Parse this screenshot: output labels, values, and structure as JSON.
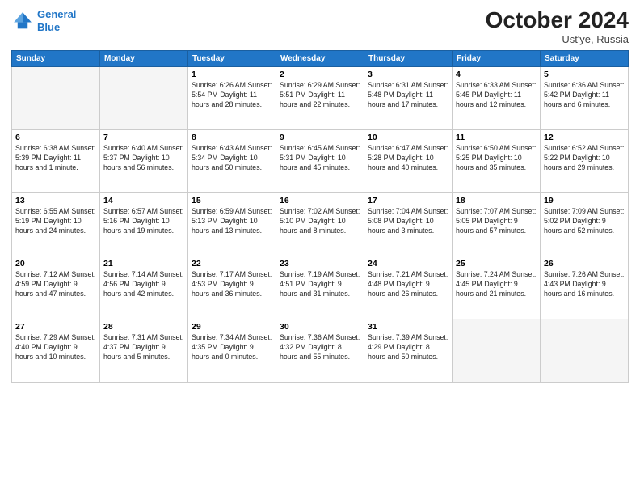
{
  "logo": {
    "line1": "General",
    "line2": "Blue"
  },
  "title": "October 2024",
  "location": "Ust'ye, Russia",
  "days_of_week": [
    "Sunday",
    "Monday",
    "Tuesday",
    "Wednesday",
    "Thursday",
    "Friday",
    "Saturday"
  ],
  "weeks": [
    [
      {
        "day": "",
        "text": ""
      },
      {
        "day": "",
        "text": ""
      },
      {
        "day": "1",
        "text": "Sunrise: 6:26 AM\nSunset: 5:54 PM\nDaylight: 11 hours and 28 minutes."
      },
      {
        "day": "2",
        "text": "Sunrise: 6:29 AM\nSunset: 5:51 PM\nDaylight: 11 hours and 22 minutes."
      },
      {
        "day": "3",
        "text": "Sunrise: 6:31 AM\nSunset: 5:48 PM\nDaylight: 11 hours and 17 minutes."
      },
      {
        "day": "4",
        "text": "Sunrise: 6:33 AM\nSunset: 5:45 PM\nDaylight: 11 hours and 12 minutes."
      },
      {
        "day": "5",
        "text": "Sunrise: 6:36 AM\nSunset: 5:42 PM\nDaylight: 11 hours and 6 minutes."
      }
    ],
    [
      {
        "day": "6",
        "text": "Sunrise: 6:38 AM\nSunset: 5:39 PM\nDaylight: 11 hours and 1 minute."
      },
      {
        "day": "7",
        "text": "Sunrise: 6:40 AM\nSunset: 5:37 PM\nDaylight: 10 hours and 56 minutes."
      },
      {
        "day": "8",
        "text": "Sunrise: 6:43 AM\nSunset: 5:34 PM\nDaylight: 10 hours and 50 minutes."
      },
      {
        "day": "9",
        "text": "Sunrise: 6:45 AM\nSunset: 5:31 PM\nDaylight: 10 hours and 45 minutes."
      },
      {
        "day": "10",
        "text": "Sunrise: 6:47 AM\nSunset: 5:28 PM\nDaylight: 10 hours and 40 minutes."
      },
      {
        "day": "11",
        "text": "Sunrise: 6:50 AM\nSunset: 5:25 PM\nDaylight: 10 hours and 35 minutes."
      },
      {
        "day": "12",
        "text": "Sunrise: 6:52 AM\nSunset: 5:22 PM\nDaylight: 10 hours and 29 minutes."
      }
    ],
    [
      {
        "day": "13",
        "text": "Sunrise: 6:55 AM\nSunset: 5:19 PM\nDaylight: 10 hours and 24 minutes."
      },
      {
        "day": "14",
        "text": "Sunrise: 6:57 AM\nSunset: 5:16 PM\nDaylight: 10 hours and 19 minutes."
      },
      {
        "day": "15",
        "text": "Sunrise: 6:59 AM\nSunset: 5:13 PM\nDaylight: 10 hours and 13 minutes."
      },
      {
        "day": "16",
        "text": "Sunrise: 7:02 AM\nSunset: 5:10 PM\nDaylight: 10 hours and 8 minutes."
      },
      {
        "day": "17",
        "text": "Sunrise: 7:04 AM\nSunset: 5:08 PM\nDaylight: 10 hours and 3 minutes."
      },
      {
        "day": "18",
        "text": "Sunrise: 7:07 AM\nSunset: 5:05 PM\nDaylight: 9 hours and 57 minutes."
      },
      {
        "day": "19",
        "text": "Sunrise: 7:09 AM\nSunset: 5:02 PM\nDaylight: 9 hours and 52 minutes."
      }
    ],
    [
      {
        "day": "20",
        "text": "Sunrise: 7:12 AM\nSunset: 4:59 PM\nDaylight: 9 hours and 47 minutes."
      },
      {
        "day": "21",
        "text": "Sunrise: 7:14 AM\nSunset: 4:56 PM\nDaylight: 9 hours and 42 minutes."
      },
      {
        "day": "22",
        "text": "Sunrise: 7:17 AM\nSunset: 4:53 PM\nDaylight: 9 hours and 36 minutes."
      },
      {
        "day": "23",
        "text": "Sunrise: 7:19 AM\nSunset: 4:51 PM\nDaylight: 9 hours and 31 minutes."
      },
      {
        "day": "24",
        "text": "Sunrise: 7:21 AM\nSunset: 4:48 PM\nDaylight: 9 hours and 26 minutes."
      },
      {
        "day": "25",
        "text": "Sunrise: 7:24 AM\nSunset: 4:45 PM\nDaylight: 9 hours and 21 minutes."
      },
      {
        "day": "26",
        "text": "Sunrise: 7:26 AM\nSunset: 4:43 PM\nDaylight: 9 hours and 16 minutes."
      }
    ],
    [
      {
        "day": "27",
        "text": "Sunrise: 7:29 AM\nSunset: 4:40 PM\nDaylight: 9 hours and 10 minutes."
      },
      {
        "day": "28",
        "text": "Sunrise: 7:31 AM\nSunset: 4:37 PM\nDaylight: 9 hours and 5 minutes."
      },
      {
        "day": "29",
        "text": "Sunrise: 7:34 AM\nSunset: 4:35 PM\nDaylight: 9 hours and 0 minutes."
      },
      {
        "day": "30",
        "text": "Sunrise: 7:36 AM\nSunset: 4:32 PM\nDaylight: 8 hours and 55 minutes."
      },
      {
        "day": "31",
        "text": "Sunrise: 7:39 AM\nSunset: 4:29 PM\nDaylight: 8 hours and 50 minutes."
      },
      {
        "day": "",
        "text": ""
      },
      {
        "day": "",
        "text": ""
      }
    ]
  ]
}
